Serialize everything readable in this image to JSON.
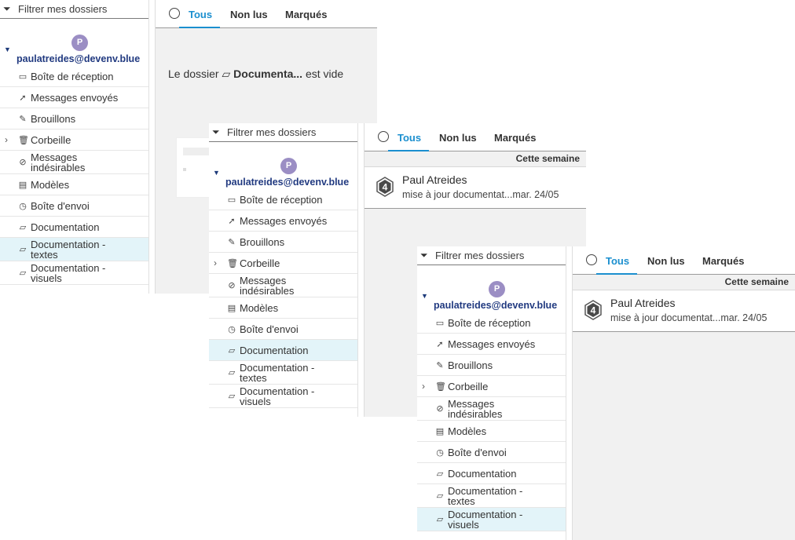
{
  "filter_label": "Filtrer mes dossiers",
  "account": {
    "avatar_letter": "P",
    "email": "paulatreides@devenv.blue"
  },
  "folders": [
    {
      "label": "Boîte de réception",
      "icon": "inbox-icon"
    },
    {
      "label": "Messages envoyés",
      "icon": "send-icon"
    },
    {
      "label": "Brouillons",
      "icon": "pencil-icon"
    },
    {
      "label": "Corbeille",
      "icon": "trash-icon"
    },
    {
      "label": "Messages indésirables",
      "icon": "spam-icon"
    },
    {
      "label": "Modèles",
      "icon": "templates-icon"
    },
    {
      "label": "Boîte d'envoi",
      "icon": "clock-icon"
    },
    {
      "label": "Documentation",
      "icon": "folder-icon"
    },
    {
      "label": "Documentation - textes",
      "icon": "folder-icon"
    },
    {
      "label": "Documentation - visuels",
      "icon": "folder-icon"
    }
  ],
  "tabs": {
    "all": "Tous",
    "unread": "Non lus",
    "flagged": "Marqués"
  },
  "empty": {
    "prefix": "Le dossier",
    "folder": "Documenta...",
    "suffix": "est vide"
  },
  "week_header": "Cette semaine",
  "message": {
    "sender": "Paul Atreides",
    "snippet": "mise à jour documentat...",
    "date": "mar. 24/05",
    "badge": "4"
  },
  "colors": {
    "accent": "#1b8fcf",
    "selected_bg": "#e3f4f9",
    "avatar": "#9b8ec4",
    "email": "#213a80"
  }
}
